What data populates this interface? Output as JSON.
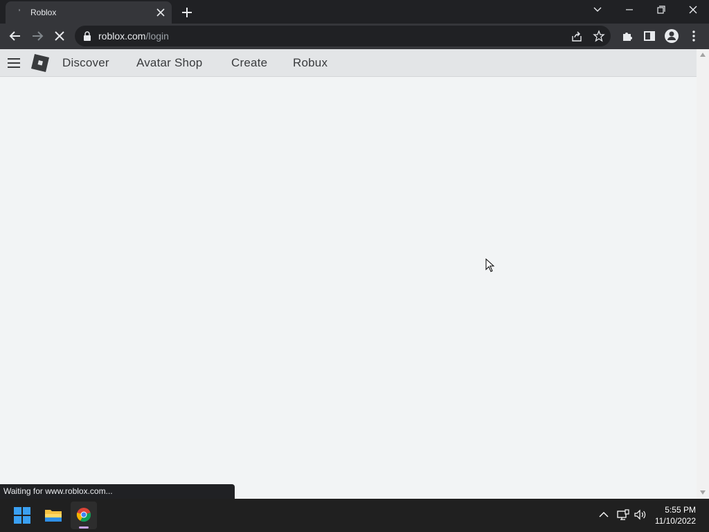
{
  "browser": {
    "tab": {
      "title": "Roblox"
    },
    "address": {
      "domain": "roblox.com",
      "path": "/login"
    },
    "status": "Waiting for www.roblox.com..."
  },
  "site": {
    "nav": [
      {
        "label": "Discover"
      },
      {
        "label": "Avatar Shop"
      },
      {
        "label": "Create"
      },
      {
        "label": "Robux"
      }
    ]
  },
  "taskbar": {
    "time": "5:55 PM",
    "date": "11/10/2022"
  },
  "colors": {
    "browser_frame": "#202124",
    "toolbar": "#35363a",
    "page_bg": "#f2f4f5",
    "site_header": "#e3e5e7",
    "taskbar": "#202020",
    "windows_blue": "#3aa0f3"
  }
}
